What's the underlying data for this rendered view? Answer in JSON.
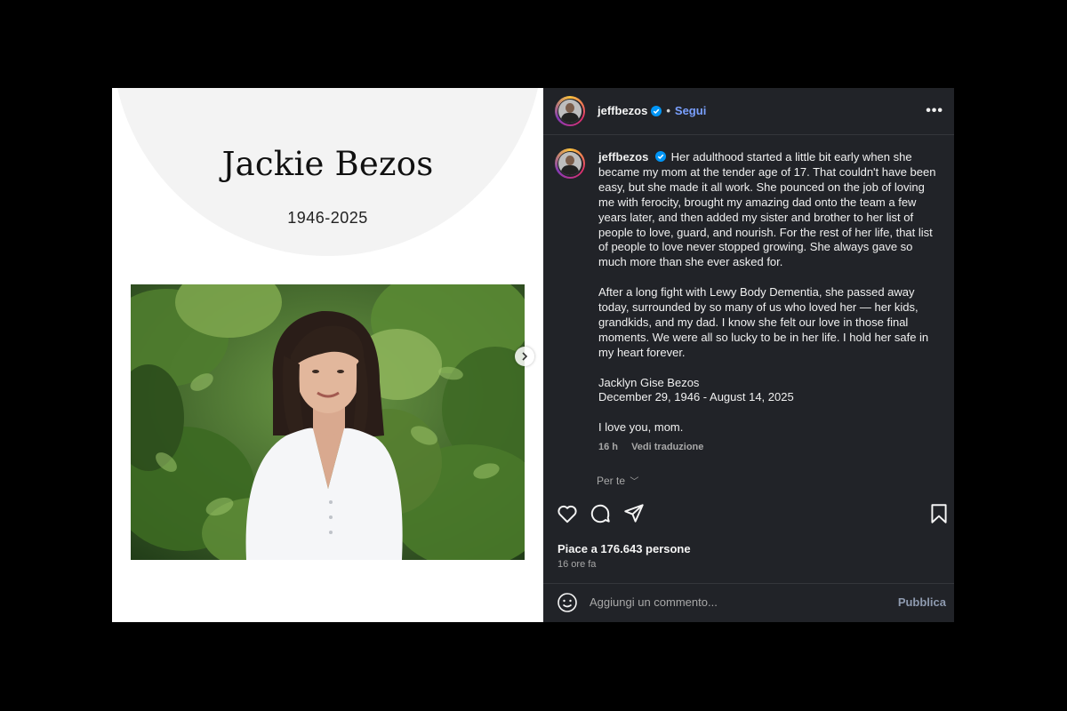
{
  "media": {
    "title": "Jackie Bezos",
    "years": "1946-2025"
  },
  "header": {
    "username": "jeffbezos",
    "separator": "•",
    "follow_label": "Segui",
    "more_label": "•••"
  },
  "caption": {
    "username": "jeffbezos",
    "paragraph1": "Her adulthood started a little bit early when she became my mom at the tender age of 17. That couldn't have been easy, but she made it all work. She pounced on the job of loving me with ferocity, brought my amazing dad onto the team a few years later, and then added my sister and brother to her list of people to love, guard, and nourish. For the rest of her life, that list of people to love never stopped growing. She always gave so much more than she ever asked for.",
    "paragraph2": "After a long fight with Lewy Body Dementia, she passed away today, surrounded by so many of us who loved her — her kids, grandkids, and my dad. I know she felt our love in those final moments. We were all so lucky to be in her life. I hold her safe in my heart forever.",
    "name_line": "Jacklyn Gise Bezos",
    "dates_line": "December 29, 1946 - August 14, 2025",
    "closing": "I love you, mom.",
    "age": "16 h",
    "translate_label": "Vedi traduzione"
  },
  "for_you": {
    "label": "Per te",
    "chevron": "﹀"
  },
  "stats": {
    "likes": "Piace a 176.643 persone",
    "time": "16 ore fa"
  },
  "comment": {
    "placeholder": "Aggiungi un commento...",
    "publish_label": "Pubblica"
  },
  "colors": {
    "panel_bg": "#212328",
    "follow": "#7aa0ff",
    "verified": "#0095f6"
  },
  "icons": [
    "heart-icon",
    "comment-icon",
    "share-icon",
    "bookmark-icon",
    "emoji-icon",
    "verified-badge-icon",
    "chevron-right-icon",
    "more-options-icon"
  ]
}
